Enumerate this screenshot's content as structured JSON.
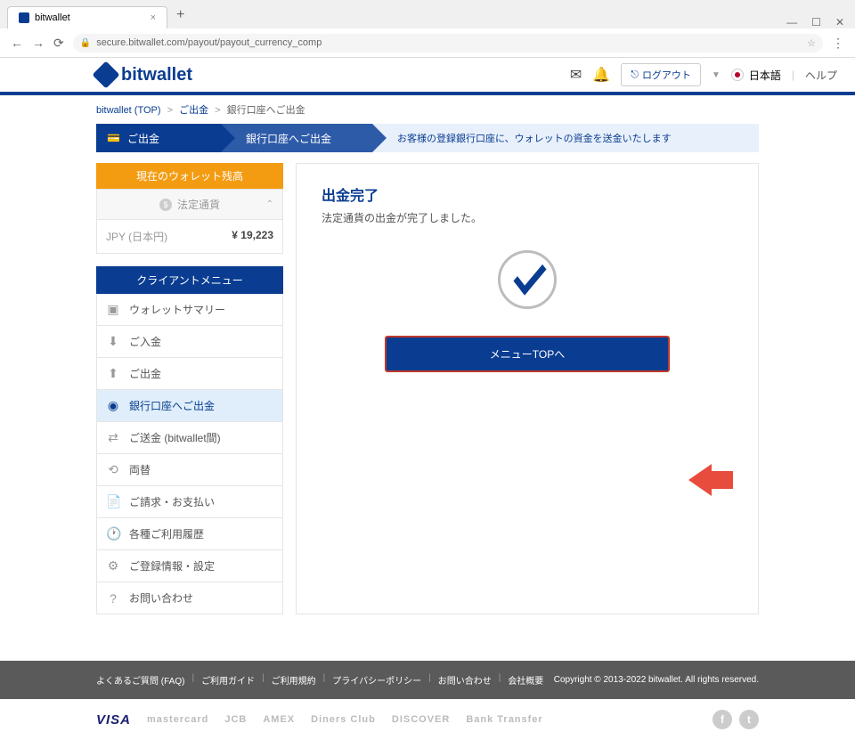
{
  "browser": {
    "tab_title": "bitwallet",
    "url": "secure.bitwallet.com/payout/payout_currency_comp"
  },
  "header": {
    "brand": "bitwallet",
    "logout": "ログアウト",
    "language": "日本語",
    "help": "ヘルプ"
  },
  "breadcrumb": {
    "top": "bitwallet (TOP)",
    "mid": "ご出金",
    "current": "銀行口座へご出金"
  },
  "steps": {
    "s1": "ご出金",
    "s2": "銀行口座へご出金",
    "desc": "お客様の登録銀行口座に、ウォレットの資金を送金いたします"
  },
  "balance": {
    "header": "現在のウォレット残高",
    "sub": "法定通貨",
    "currency_label": "JPY (日本円)",
    "amount": "¥ 19,223"
  },
  "menu": {
    "header": "クライアントメニュー",
    "items": [
      "ウォレットサマリー",
      "ご入金",
      "ご出金",
      "銀行口座へご出金",
      "ご送金 (bitwallet間)",
      "両替",
      "ご請求・お支払い",
      "各種ご利用履歴",
      "ご登録情報・設定",
      "お問い合わせ"
    ]
  },
  "panel": {
    "title": "出金完了",
    "subtitle": "法定通貨の出金が完了しました。",
    "button": "メニューTOPへ"
  },
  "footer": {
    "links": [
      "よくあるご質問 (FAQ)",
      "ご利用ガイド",
      "ご利用規約",
      "プライバシーポリシー",
      "お問い合わせ",
      "会社概要"
    ],
    "copyright": "Copyright © 2013-2022 bitwallet. All rights reserved."
  },
  "payments": [
    "VISA",
    "mastercard",
    "JCB",
    "AMEX",
    "Diners Club",
    "DISCOVER",
    "Bank Transfer"
  ]
}
